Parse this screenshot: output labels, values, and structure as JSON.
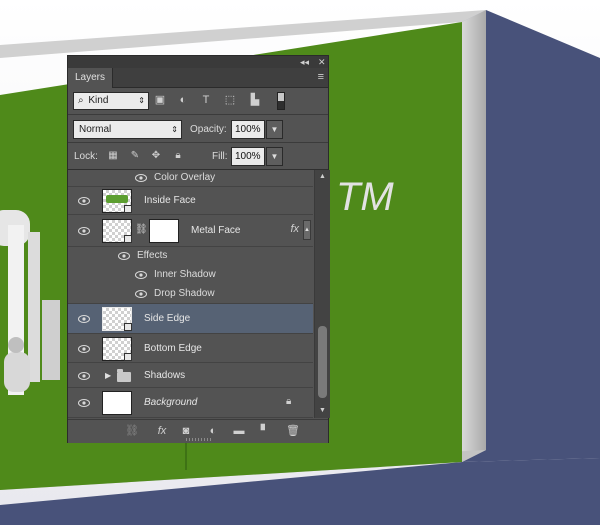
{
  "canvas": {
    "trademark": "TM",
    "colors": {
      "green_face": "#4f8a1a",
      "blue_side": "#48527a",
      "edge_grey": "#c8c8c8",
      "background": "#ffffff"
    }
  },
  "panel": {
    "title_buttons": {
      "collapse": "◂◂",
      "close": "✕"
    },
    "tab_label": "Layers",
    "menu_icon": "panel-menu-icon",
    "filter": {
      "kind_label": "Kind",
      "icons": [
        "image-filter-icon",
        "adjustment-filter-icon",
        "type-filter-icon",
        "shape-filter-icon",
        "smart-object-filter-icon"
      ]
    },
    "blend_mode": "Normal",
    "opacity_label": "Opacity:",
    "opacity_value": "100%",
    "lock_label": "Lock:",
    "lock_icons": [
      "lock-transparent-pixels-icon",
      "lock-image-pixels-icon",
      "lock-position-icon",
      "lock-all-icon"
    ],
    "fill_label": "Fill:",
    "fill_value": "100%",
    "layers": [
      {
        "type": "effect",
        "label": "Color Overlay"
      },
      {
        "type": "layer",
        "name": "Inside Face"
      },
      {
        "type": "layer",
        "name": "Metal Face",
        "fx": "fx"
      },
      {
        "type": "effects-header",
        "label": "Effects"
      },
      {
        "type": "effect",
        "label": "Inner Shadow"
      },
      {
        "type": "effect",
        "label": "Drop Shadow"
      },
      {
        "type": "layer",
        "name": "Side Edge",
        "selected": true
      },
      {
        "type": "layer",
        "name": "Bottom Edge"
      },
      {
        "type": "group",
        "name": "Shadows"
      },
      {
        "type": "layer",
        "name": "Background",
        "locked": true
      }
    ],
    "footer_icons": [
      "link-layers-icon",
      "add-layer-style-icon",
      "add-mask-icon",
      "new-adjustment-layer-icon",
      "new-group-icon",
      "new-layer-icon",
      "delete-layer-icon"
    ],
    "footer_fx": "fx"
  }
}
